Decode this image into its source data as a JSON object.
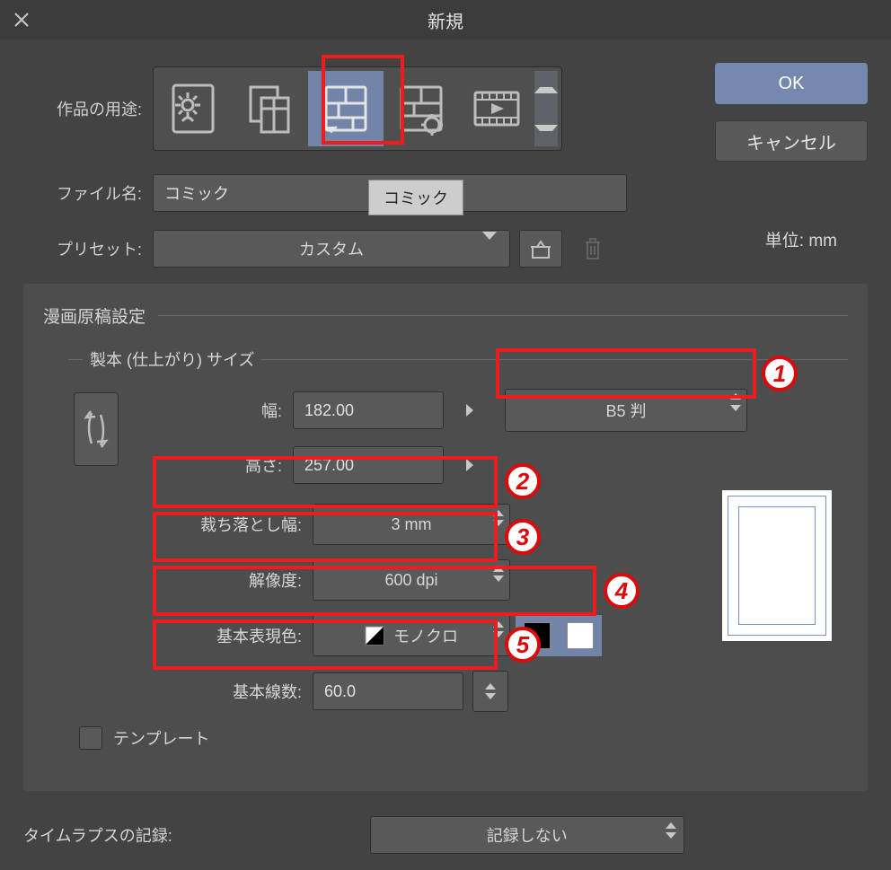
{
  "title": "新規",
  "use_label": "作品の用途:",
  "tooltip": "コミック",
  "file_label": "ファイル名:",
  "file_value": "コミック",
  "preset_label": "プリセット:",
  "preset_value": "カスタム",
  "unit_label": "単位:",
  "unit_value": "mm",
  "ok_label": "OK",
  "cancel_label": "キャンセル",
  "panel_title": "漫画原稿設定",
  "binding_title": "製本 (仕上がり) サイズ",
  "width_label": "幅:",
  "width_value": "182.00",
  "height_label": "高さ:",
  "height_value": "257.00",
  "size_preset": "B5 判",
  "bleed_label": "裁ち落とし幅:",
  "bleed_value": "3 mm",
  "resolution_label": "解像度:",
  "resolution_value": "600 dpi",
  "color_label": "基本表現色:",
  "color_value": "モノクロ",
  "lines_label": "基本線数:",
  "lines_value": "60.0",
  "template_label": "テンプレート",
  "timelapse_label": "タイムラプスの記録:",
  "timelapse_value": "記録しない",
  "annotations": {
    "n1": "1",
    "n2": "2",
    "n3": "3",
    "n4": "4",
    "n5": "5"
  }
}
